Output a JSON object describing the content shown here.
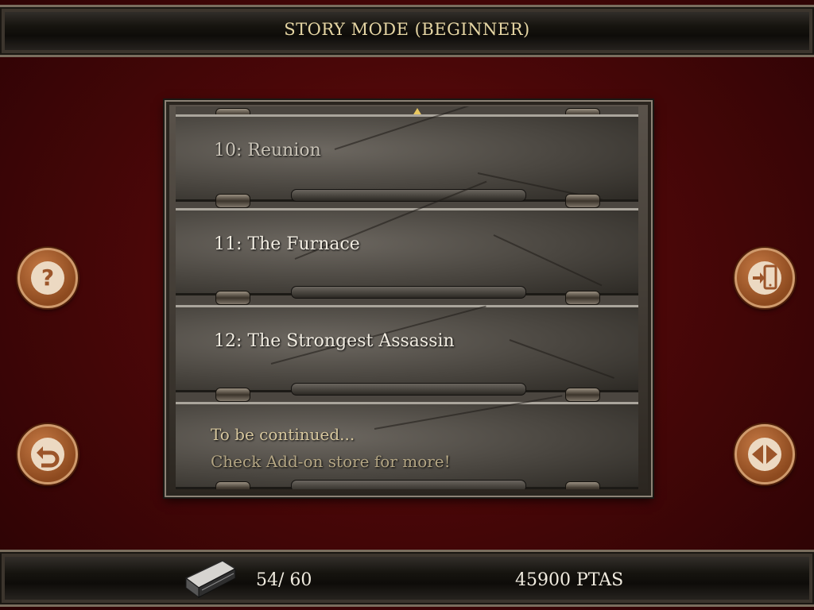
{
  "header": {
    "title": "STORY MODE (BEGINNER)"
  },
  "chapters": [
    {
      "label": "10: Reunion",
      "state": "dim"
    },
    {
      "label": "11: The Furnace",
      "state": "normal"
    },
    {
      "label": "12: The Strongest Assassin",
      "state": "normal"
    }
  ],
  "continued": {
    "line1": "To be continued...",
    "line2": "Check Add-on store for more!"
  },
  "buttons": {
    "help": "question-icon",
    "back": "back-arrow-icon",
    "device": "device-transfer-icon",
    "toggle": "toggle-arrows-icon"
  },
  "footer": {
    "progress": "54/ 60",
    "money": "45900 PTAS"
  },
  "colors": {
    "background": "#4a0708",
    "button": "#a85d2c",
    "title_text": "#e6d6a4",
    "scroll_arrow": "#e9c860"
  }
}
